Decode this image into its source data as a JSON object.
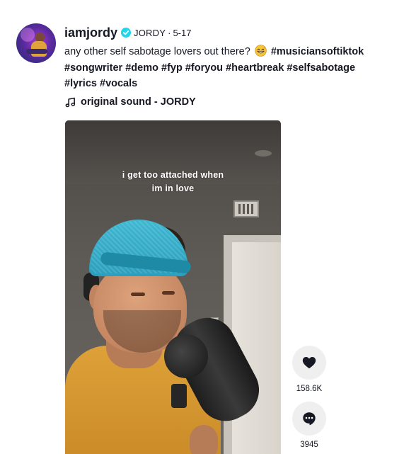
{
  "post": {
    "username": "iamjordy",
    "nickname": "JORDY",
    "separator": "·",
    "date": "5-17",
    "caption_text": "any other self sabotage lovers out there?",
    "hashtags": [
      "#musiciansoftiktok",
      "#songwriter",
      "#demo",
      "#fyp",
      "#foryou",
      "#heartbreak",
      "#selfsabotage",
      "#lyrics",
      "#vocals"
    ],
    "sound": "original sound - JORDY"
  },
  "video": {
    "overlay_line1": "i get too attached when",
    "overlay_line2": "im in love"
  },
  "actions": {
    "likes": "158.6K",
    "comments": "3945"
  },
  "icons": {
    "verified": "verified-badge-icon",
    "emoji": "grinning-sweat-emoji-icon",
    "music": "music-note-icon",
    "like": "heart-icon",
    "comment": "comment-bubble-icon"
  },
  "colors": {
    "text": "#161823",
    "verified": "#20D5EC",
    "action_bg": "#EFEFEF"
  }
}
